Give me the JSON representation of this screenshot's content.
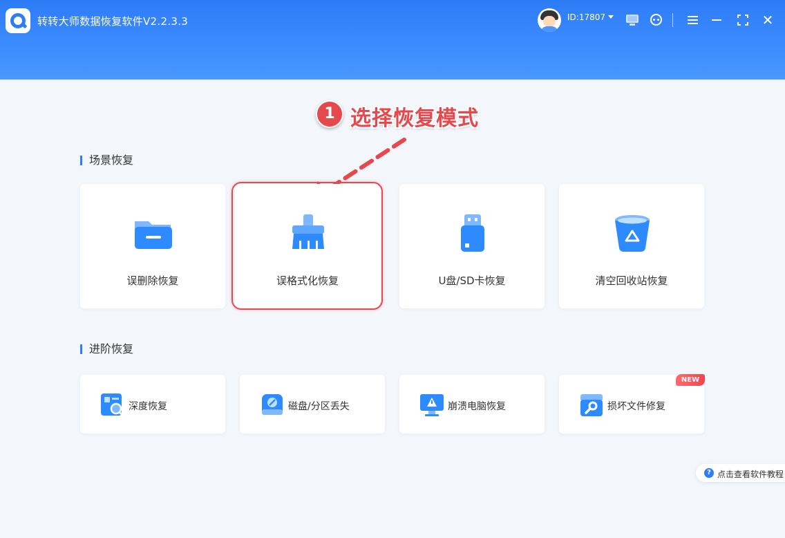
{
  "app": {
    "title": "转转大师数据恢复软件V2.2.3.3",
    "user_id": "ID:17807",
    "accent_color": "#2e7cf6"
  },
  "header_icons": [
    "monitor-icon",
    "support-icon",
    "menu-icon",
    "minimize-icon",
    "maximize-icon",
    "close-icon"
  ],
  "header_close_glyph": "✕",
  "annotation": {
    "step_number": "1",
    "step_text": "选择恢复模式",
    "color": "#e5484d"
  },
  "sections": {
    "scenario": {
      "title": "场景恢复",
      "cards": [
        {
          "label": "误删除恢复",
          "icon": "folder-icon"
        },
        {
          "label": "误格式化恢复",
          "icon": "brush-icon",
          "highlighted": true
        },
        {
          "label": "U盘/SD卡恢复",
          "icon": "usb-drive-icon"
        },
        {
          "label": "清空回收站恢复",
          "icon": "recycle-bin-icon"
        }
      ]
    },
    "advanced": {
      "title": "进阶恢复",
      "cards": [
        {
          "label": "深度恢复",
          "icon": "deep-scan-icon"
        },
        {
          "label": "磁盘/分区丢失",
          "icon": "disk-icon"
        },
        {
          "label": "崩溃电脑恢复",
          "icon": "crashed-pc-icon"
        },
        {
          "label": "损坏文件修复",
          "icon": "file-repair-icon",
          "badge": "NEW"
        }
      ]
    }
  },
  "help": {
    "icon_glyph": "?",
    "text": "点击查看软件教程"
  }
}
